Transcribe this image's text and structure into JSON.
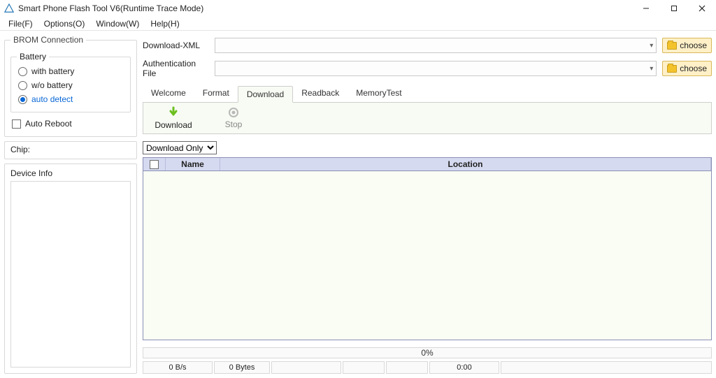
{
  "window": {
    "title": "Smart Phone Flash Tool V6(Runtime Trace Mode)"
  },
  "menu": {
    "file": "File(F)",
    "options": "Options(O)",
    "window": "Window(W)",
    "help": "Help(H)"
  },
  "brom": {
    "group_label": "BROM Connection",
    "battery_label": "Battery",
    "with_battery": "with battery",
    "wo_battery": "w/o battery",
    "auto_detect": "auto detect",
    "auto_reboot": "Auto Reboot"
  },
  "chip": {
    "label": "Chip:"
  },
  "device": {
    "label": "Device Info"
  },
  "filepickers": {
    "xml_label": "Download-XML",
    "auth_label": "Authentication File",
    "choose": "choose"
  },
  "tabs": {
    "welcome": "Welcome",
    "format": "Format",
    "download": "Download",
    "readback": "Readback",
    "memorytest": "MemoryTest"
  },
  "toolbar": {
    "download": "Download",
    "stop": "Stop"
  },
  "download_mode": {
    "selected": "Download Only",
    "options": [
      "Download Only"
    ]
  },
  "table": {
    "name_header": "Name",
    "location_header": "Location",
    "rows": []
  },
  "progress": {
    "text": "0%"
  },
  "status": {
    "speed": "0 B/s",
    "bytes": "0 Bytes",
    "s3": "",
    "s4": "",
    "s5": "",
    "time": "0:00",
    "s7": ""
  }
}
